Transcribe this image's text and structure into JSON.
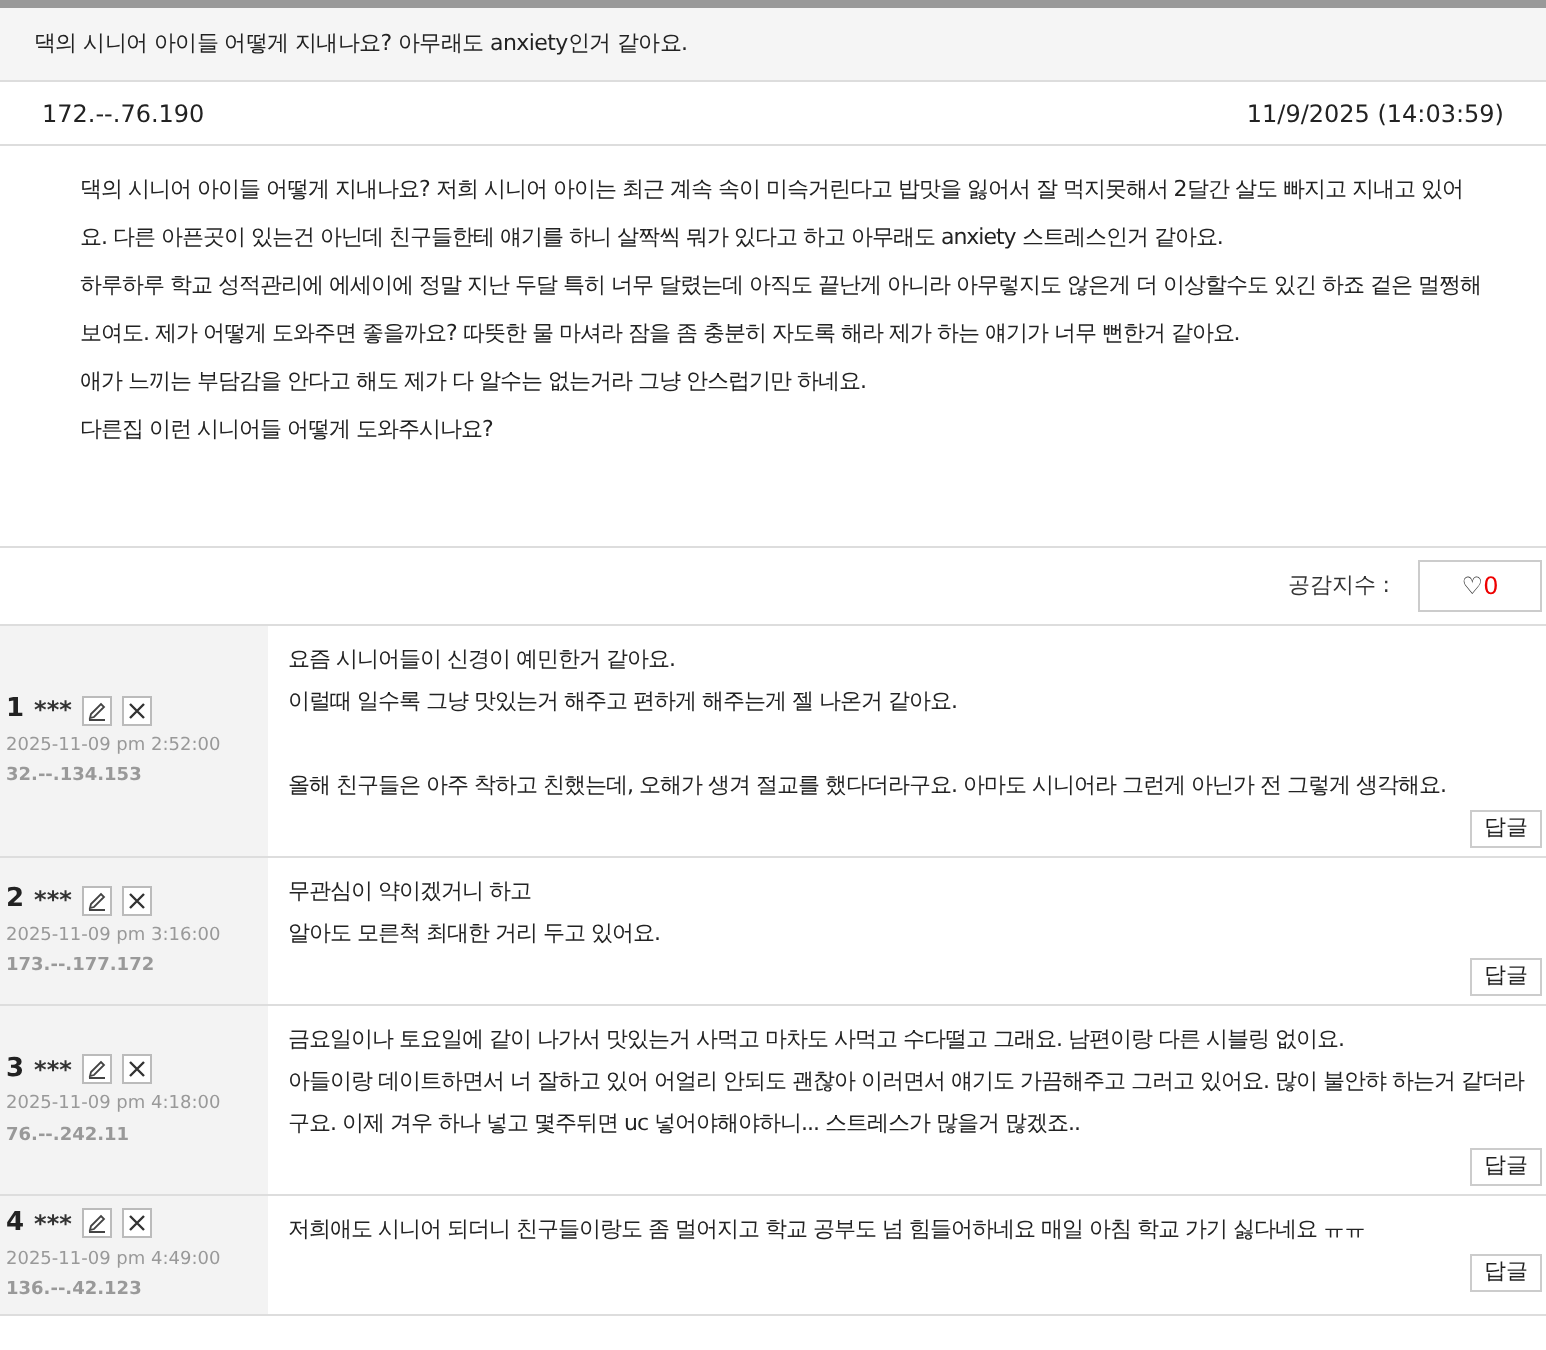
{
  "post": {
    "title": "댁의 시니어 아이들 어떻게 지내나요? 아무래도 anxiety인거 같아요.",
    "ip": "172.--.76.190",
    "date": "11/9/2025 (14:03:59)",
    "body": [
      "댁의 시니어 아이들 어떻게 지내나요? 저희 시니어 아이는 최근 계속 속이 미슥거린다고 밥맛을 잃어서 잘 먹지못해서 2달간 살도 빠지고 지내고 있어요. 다른 아픈곳이 있는건 아닌데 친구들한테 얘기를 하니 살짝씩 뭐가 있다고 하고 아무래도 anxiety 스트레스인거 같아요.",
      "하루하루 학교 성적관리에 에세이에 정말 지난 두달 특히 너무 달렸는데 아직도 끝난게 아니라 아무렇지도 않은게 더 이상할수도 있긴 하죠 겉은 멀쩡해보여도. 제가 어떻게 도와주면 좋을까요? 따뜻한 물 마셔라 잠을 좀 충분히 자도록 해라 제가 하는 얘기가 너무 뻔한거 같아요.",
      "애가 느끼는 부담감을 안다고 해도 제가 다 알수는 없는거라 그냥 안스럽기만 하네요.",
      "다른집 이런 시니어들 어떻게 도와주시나요?"
    ]
  },
  "likes": {
    "label": "공감지수 :",
    "icon": "♡",
    "count": "0"
  },
  "comments": [
    {
      "number": "1",
      "author": "***",
      "time": "2025-11-09 pm 2:52:00",
      "ip": "32.--.134.153",
      "paragraphs": [
        [
          "요즘 시니어들이 신경이 예민한거 같아요.",
          "이럴때 일수록 그냥 맛있는거 해주고 편하게 해주는게 젤 나온거 같아요."
        ],
        [
          "올해 친구들은 아주 착하고 친했는데, 오해가 생겨 절교를 했다더라구요. 아마도 시니어라 그런게 아닌가 전 그렇게 생각해요."
        ]
      ],
      "reply": "답글"
    },
    {
      "number": "2",
      "author": "***",
      "time": "2025-11-09 pm 3:16:00",
      "ip": "173.--.177.172",
      "paragraphs": [
        [
          "무관심이 약이겠거니 하고",
          "알아도 모른척 최대한 거리 두고 있어요."
        ]
      ],
      "reply": "답글"
    },
    {
      "number": "3",
      "author": "***",
      "time": "2025-11-09 pm 4:18:00",
      "ip": "76.--.242.11",
      "paragraphs": [
        [
          "금요일이나 토요일에 같이 나가서 맛있는거 사먹고 마차도 사먹고 수다떨고 그래요. 남편이랑 다른 시블링 없이요.",
          "아들이랑 데이트하면서 너 잘하고 있어 어얼리 안되도 괜찮아 이러면서 얘기도 가끔해주고 그러고 있어요. 많이 불안햐 하는거 같더라구요. 이제 겨우 하나 넣고 몇주뒤면 uc 넣어야해야하니... 스트레스가 많을거 많겠죠.."
        ]
      ],
      "reply": "답글"
    },
    {
      "number": "4",
      "author": "***",
      "time": "2025-11-09 pm 4:49:00",
      "ip": "136.--.42.123",
      "paragraphs": [
        [
          "저희애도 시니어 되더니 친구들이랑도 좀 멀어지고 학교 공부도 넘 힘들어하네요 매일 아침 학교 가기 싫다네요 ㅠㅠ"
        ]
      ],
      "reply": "답글"
    }
  ]
}
